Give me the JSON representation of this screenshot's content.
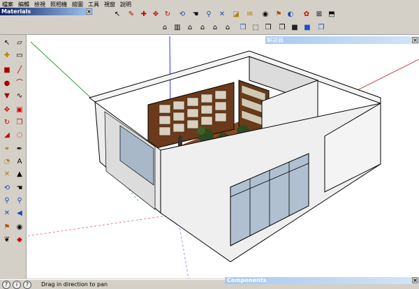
{
  "menu": [
    "檔案",
    "編輯",
    "檢視",
    "照相機",
    "繪圖",
    "工具",
    "視窗",
    "說明"
  ],
  "materials_title": "Materials",
  "guide_title": "解說員",
  "components_title": "Components",
  "status_message": "Drag in direction to pan",
  "toolbar_top": [
    "select-icon",
    "eraser-icon",
    "paint-icon",
    "move-icon",
    "rotate-icon",
    "scale-icon",
    "orbit-icon",
    "pan-icon",
    "zoom-icon",
    "zoom-extents-icon",
    "section-icon",
    "walk-icon",
    "look-around-icon",
    "position-camera-icon",
    "shadows-icon",
    "fog-icon",
    "dimension-icon",
    "text-icon"
  ],
  "toolbar_views": [
    "iso-view-icon",
    "top-view-icon",
    "front-view-icon",
    "right-view-icon",
    "back-view-icon",
    "left-view-icon",
    "xray-icon",
    "wireframe-icon",
    "hidden-line-icon",
    "shaded-icon",
    "textured-icon",
    "monochrome-icon"
  ],
  "toolbar_left": [
    "select-icon",
    "make-component-icon",
    "eraser-icon",
    "paint-bucket-icon",
    "rectangle-icon",
    "line-icon",
    "circle-icon",
    "arc-icon",
    "polygon-icon",
    "freehand-icon",
    "push-pull-icon",
    "follow-me-icon",
    "move-icon",
    "rotate-icon",
    "offset-icon",
    "scale-icon",
    "tape-measure-icon",
    "protractor-icon",
    "dimension-icon",
    "text-icon",
    "axes-icon",
    "3d-text-icon",
    "orbit-icon",
    "pan-icon",
    "zoom-icon",
    "zoom-window-icon",
    "zoom-extents-icon",
    "previous-view-icon",
    "position-camera-icon",
    "look-around-icon",
    "walk-icon",
    "section-icon"
  ]
}
